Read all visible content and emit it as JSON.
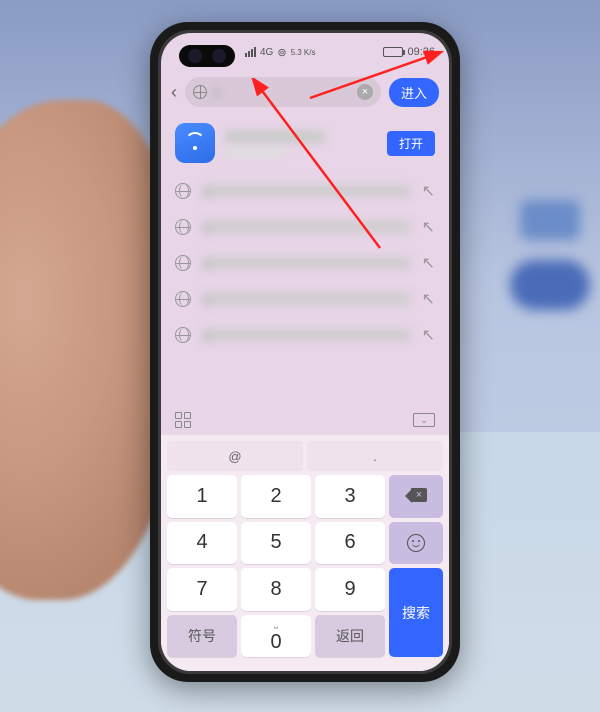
{
  "status": {
    "signal_label": "4G",
    "speed": "5.3 K/s",
    "time": "09:36"
  },
  "address_bar": {
    "value": "1",
    "enter_label": "进入"
  },
  "top_result": {
    "open_label": "打开"
  },
  "suggestions": [
    {
      "text": "1"
    },
    {
      "text": "1"
    },
    {
      "text": "1"
    },
    {
      "text": "1"
    },
    {
      "text": "1"
    }
  ],
  "keyboard": {
    "symbol_row": [
      "@",
      "."
    ],
    "num_rows": [
      [
        "1",
        "2",
        "3"
      ],
      [
        "4",
        "5",
        "6"
      ],
      [
        "7",
        "8",
        "9"
      ]
    ],
    "bottom_left": "符号",
    "bottom_right": "返回",
    "zero": "0",
    "search_label": "搜索"
  }
}
